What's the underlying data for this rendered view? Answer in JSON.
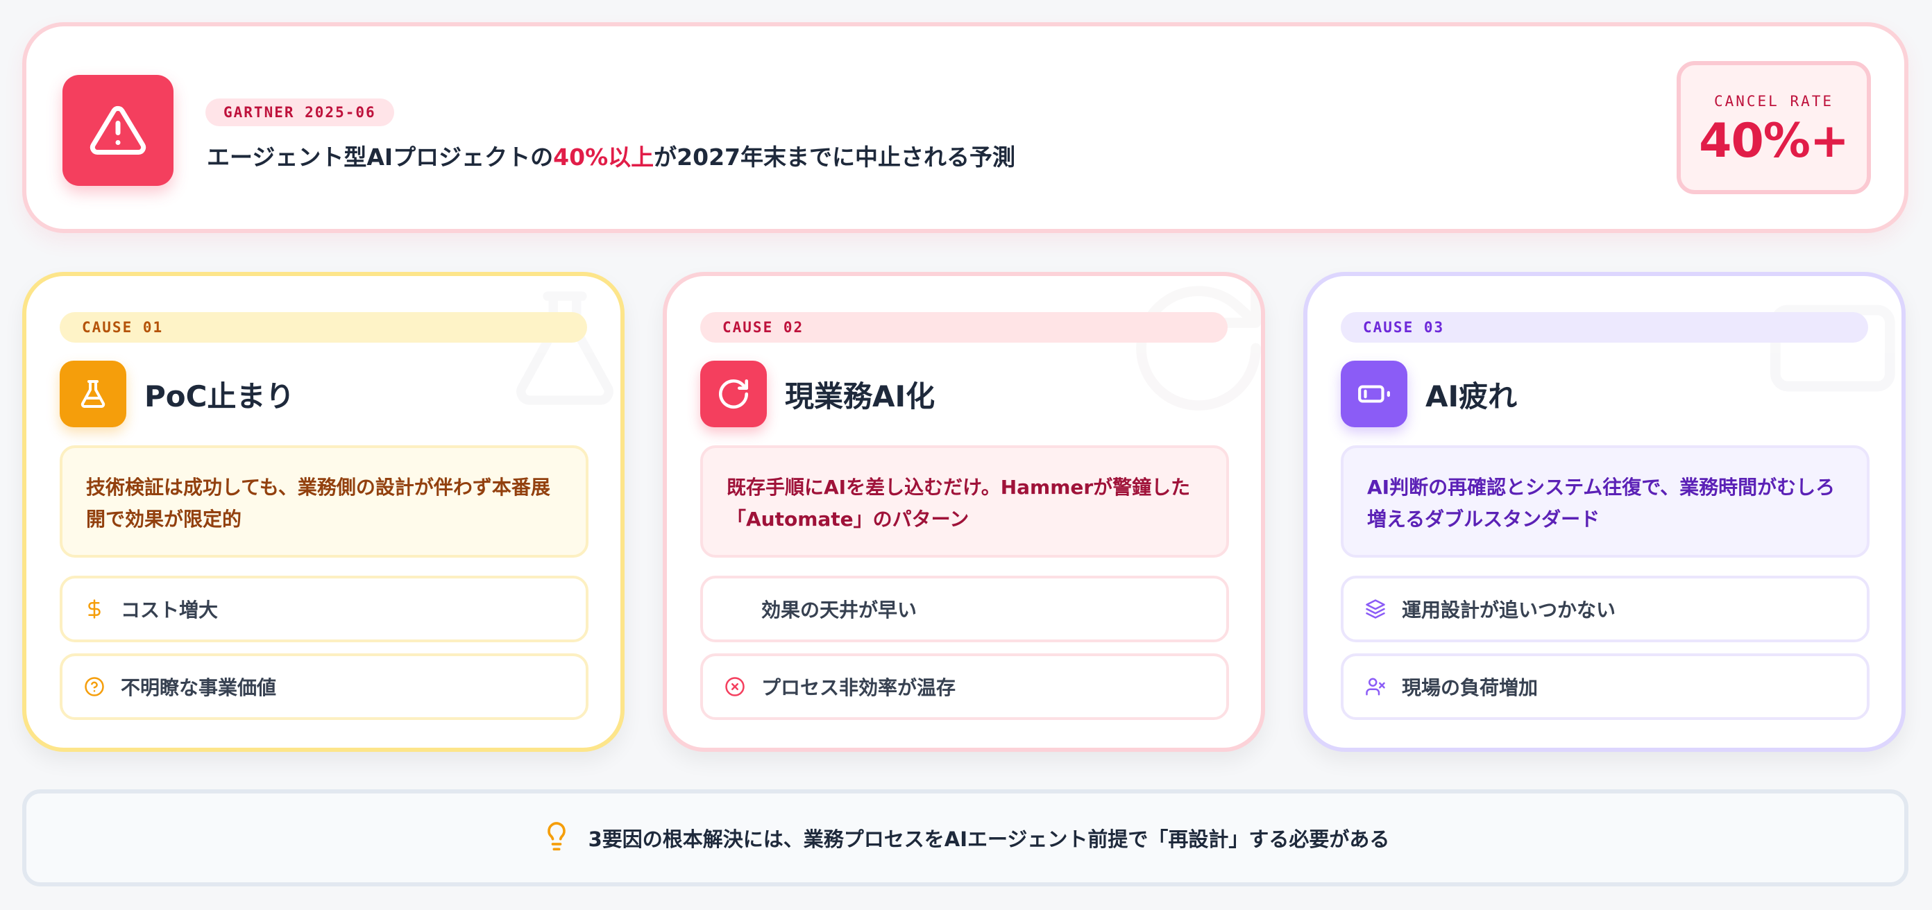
{
  "header": {
    "source_badge": "GARTNER 2025-06",
    "headline_before": "エージェント型AIプロジェクトの",
    "headline_highlight": "40%以上",
    "headline_after": "が2027年末までに中止される予測",
    "cancel_rate_label": "CANCEL RATE",
    "cancel_rate_value": "40%+",
    "icon": "warning-triangle-icon"
  },
  "causes": [
    {
      "tag": "CAUSE 01",
      "title": "PoC止まり",
      "icon": "flask-icon",
      "description": "技術検証は成功しても、業務側の設計が伴わず本番展開で効果が限定的",
      "items": [
        {
          "icon": "dollar-icon",
          "label": "コスト増大"
        },
        {
          "icon": "question-circle-icon",
          "label": "不明瞭な事業価値"
        }
      ],
      "accent": "#f59e0b"
    },
    {
      "tag": "CAUSE 02",
      "title": "現業務AI化",
      "icon": "refresh-icon",
      "description": "既存手順にAIを差し込むだけ。Hammerが警鐘した「Automate」のパターン",
      "items": [
        {
          "icon": "",
          "label": "効果の天井が早い"
        },
        {
          "icon": "x-circle-icon",
          "label": "プロセス非効率が温存"
        }
      ],
      "accent": "#f43f5e"
    },
    {
      "tag": "CAUSE 03",
      "title": "AI疲れ",
      "icon": "battery-low-icon",
      "description": "AI判断の再確認とシステム往復で、業務時間がむしろ増えるダブルスタンダード",
      "items": [
        {
          "icon": "layers-icon",
          "label": "運用設計が追いつかない"
        },
        {
          "icon": "user-x-icon",
          "label": "現場の負荷増加"
        }
      ],
      "accent": "#8b5cf6"
    }
  ],
  "footer": {
    "icon": "lightbulb-icon",
    "text": "3要因の根本解決には、業務プロセスをAIエージェント前提で「再設計」する必要がある"
  }
}
